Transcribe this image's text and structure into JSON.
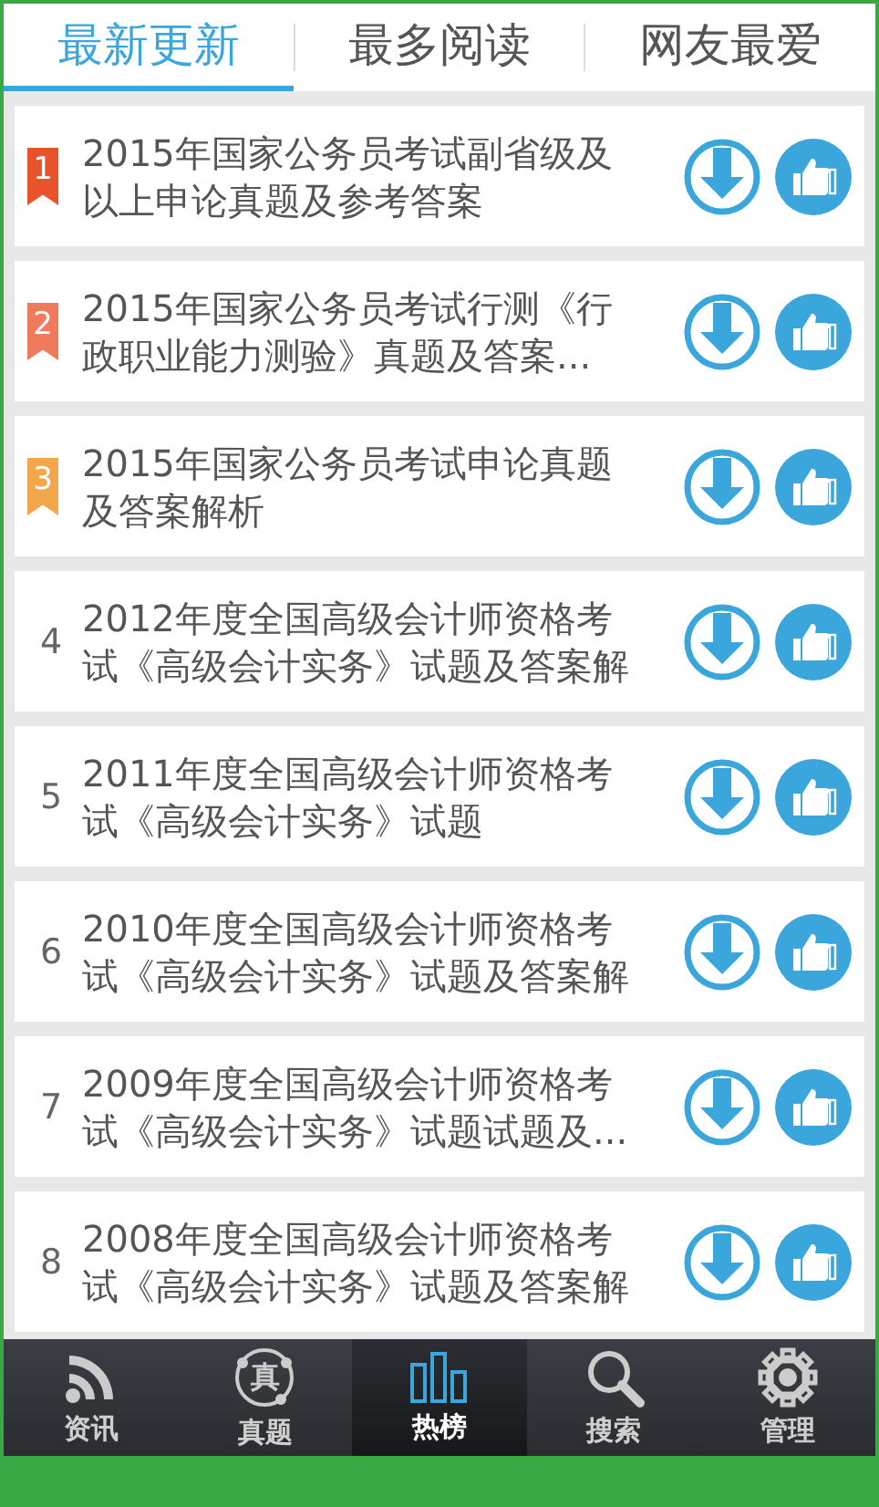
{
  "tabs": [
    {
      "label": "最新更新",
      "selected": true
    },
    {
      "label": "最多阅读",
      "selected": false
    },
    {
      "label": "网友最爱",
      "selected": false
    }
  ],
  "items": [
    {
      "rank": "1",
      "kind": "ribbon",
      "color": "#e8532b",
      "title": "2015年国家公务员考试副省级及以上申论真题及参考答案"
    },
    {
      "rank": "2",
      "kind": "ribbon",
      "color": "#f07b5c",
      "title": "2015年国家公务员考试行测《行政职业能力测验》真题及答案..."
    },
    {
      "rank": "3",
      "kind": "ribbon",
      "color": "#f2a74b",
      "title": "2015年国家公务员考试申论真题及答案解析"
    },
    {
      "rank": "4",
      "kind": "plain",
      "title": "2012年度全国高级会计师资格考试《高级会计实务》试题及答案解"
    },
    {
      "rank": "5",
      "kind": "plain",
      "title": "2011年度全国高级会计师资格考试《高级会计实务》试题"
    },
    {
      "rank": "6",
      "kind": "plain",
      "title": "2010年度全国高级会计师资格考试《高级会计实务》试题及答案解"
    },
    {
      "rank": "7",
      "kind": "plain",
      "title": "2009年度全国高级会计师资格考试《高级会计实务》试题试题及..."
    },
    {
      "rank": "8",
      "kind": "plain",
      "title": "2008年度全国高级会计师资格考试《高级会计实务》试题及答案解"
    }
  ],
  "nav": [
    {
      "label": "资讯",
      "kind": "rss",
      "selected": false
    },
    {
      "label": "真题",
      "kind": "seal",
      "glyph": "真",
      "selected": false
    },
    {
      "label": "热榜",
      "kind": "bars",
      "selected": true
    },
    {
      "label": "搜索",
      "kind": "search",
      "selected": false
    },
    {
      "label": "管理",
      "kind": "gear",
      "selected": false
    }
  ]
}
